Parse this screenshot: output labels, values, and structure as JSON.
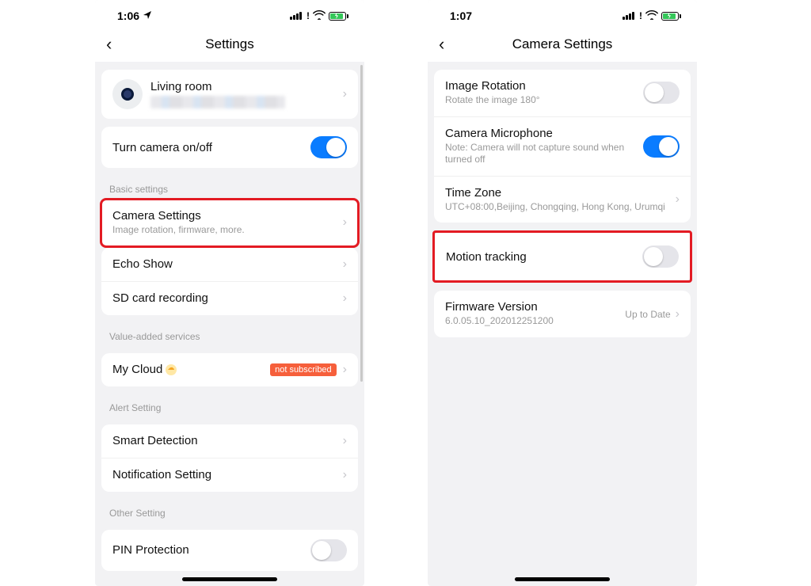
{
  "left": {
    "status_time": "1:06",
    "nav_title": "Settings",
    "device_name": "Living room",
    "toggle_label": "Turn camera on/off",
    "sections": {
      "basic": {
        "label": "Basic settings",
        "camera_settings": {
          "title": "Camera Settings",
          "sub": "Image rotation, firmware, more."
        },
        "echo_show": {
          "title": "Echo Show"
        },
        "sd_card": {
          "title": "SD card recording"
        }
      },
      "vas": {
        "label": "Value-added services",
        "my_cloud": {
          "title": "My Cloud",
          "badge": "not subscribed"
        }
      },
      "alert": {
        "label": "Alert Setting",
        "smart": {
          "title": "Smart Detection"
        },
        "notif": {
          "title": "Notification Setting"
        }
      },
      "other": {
        "label": "Other Setting",
        "pin": {
          "title": "PIN Protection"
        }
      }
    }
  },
  "right": {
    "status_time": "1:07",
    "nav_title": "Camera Settings",
    "rows": {
      "rotation": {
        "title": "Image Rotation",
        "sub": "Rotate the image 180°"
      },
      "mic": {
        "title": "Camera Microphone",
        "sub": "Note: Camera will not capture sound when turned off"
      },
      "tz": {
        "title": "Time Zone",
        "sub": "UTC+08:00,Beijing, Chongqing, Hong Kong, Urumqi"
      },
      "motion": {
        "title": "Motion tracking"
      },
      "fw": {
        "title": "Firmware Version",
        "sub": "6.0.05.10_202012251200",
        "right": "Up to Date"
      }
    }
  }
}
